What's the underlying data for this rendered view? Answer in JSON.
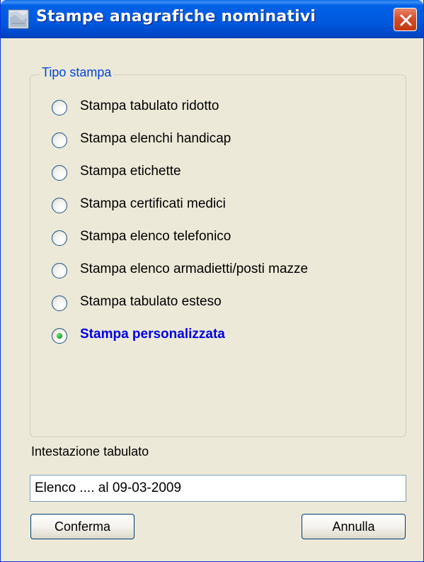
{
  "window": {
    "title": "Stampe anagrafiche nominativi",
    "icon": "print-report-icon",
    "close_icon": "close-icon"
  },
  "group": {
    "legend": "Tipo stampa",
    "options": [
      {
        "label": "Stampa tabulato ridotto",
        "selected": false
      },
      {
        "label": "Stampa elenchi handicap",
        "selected": false
      },
      {
        "label": "Stampa etichette",
        "selected": false
      },
      {
        "label": "Stampa certificati medici",
        "selected": false
      },
      {
        "label": "Stampa elenco telefonico",
        "selected": false
      },
      {
        "label": "Stampa elenco armadietti/posti mazze",
        "selected": false
      },
      {
        "label": "Stampa tabulato esteso",
        "selected": false
      },
      {
        "label": "Stampa personalizzata",
        "selected": true
      }
    ]
  },
  "header_field": {
    "label": "Intestazione tabulato",
    "value": "Elenco .... al 09-03-2009"
  },
  "buttons": {
    "confirm": "Conferma",
    "cancel": "Annulla"
  },
  "colors": {
    "title_bar": "#0058dc",
    "legend_text": "#0046d5",
    "selected_text": "#0000e0",
    "dialog_bg": "#ece9d8"
  }
}
